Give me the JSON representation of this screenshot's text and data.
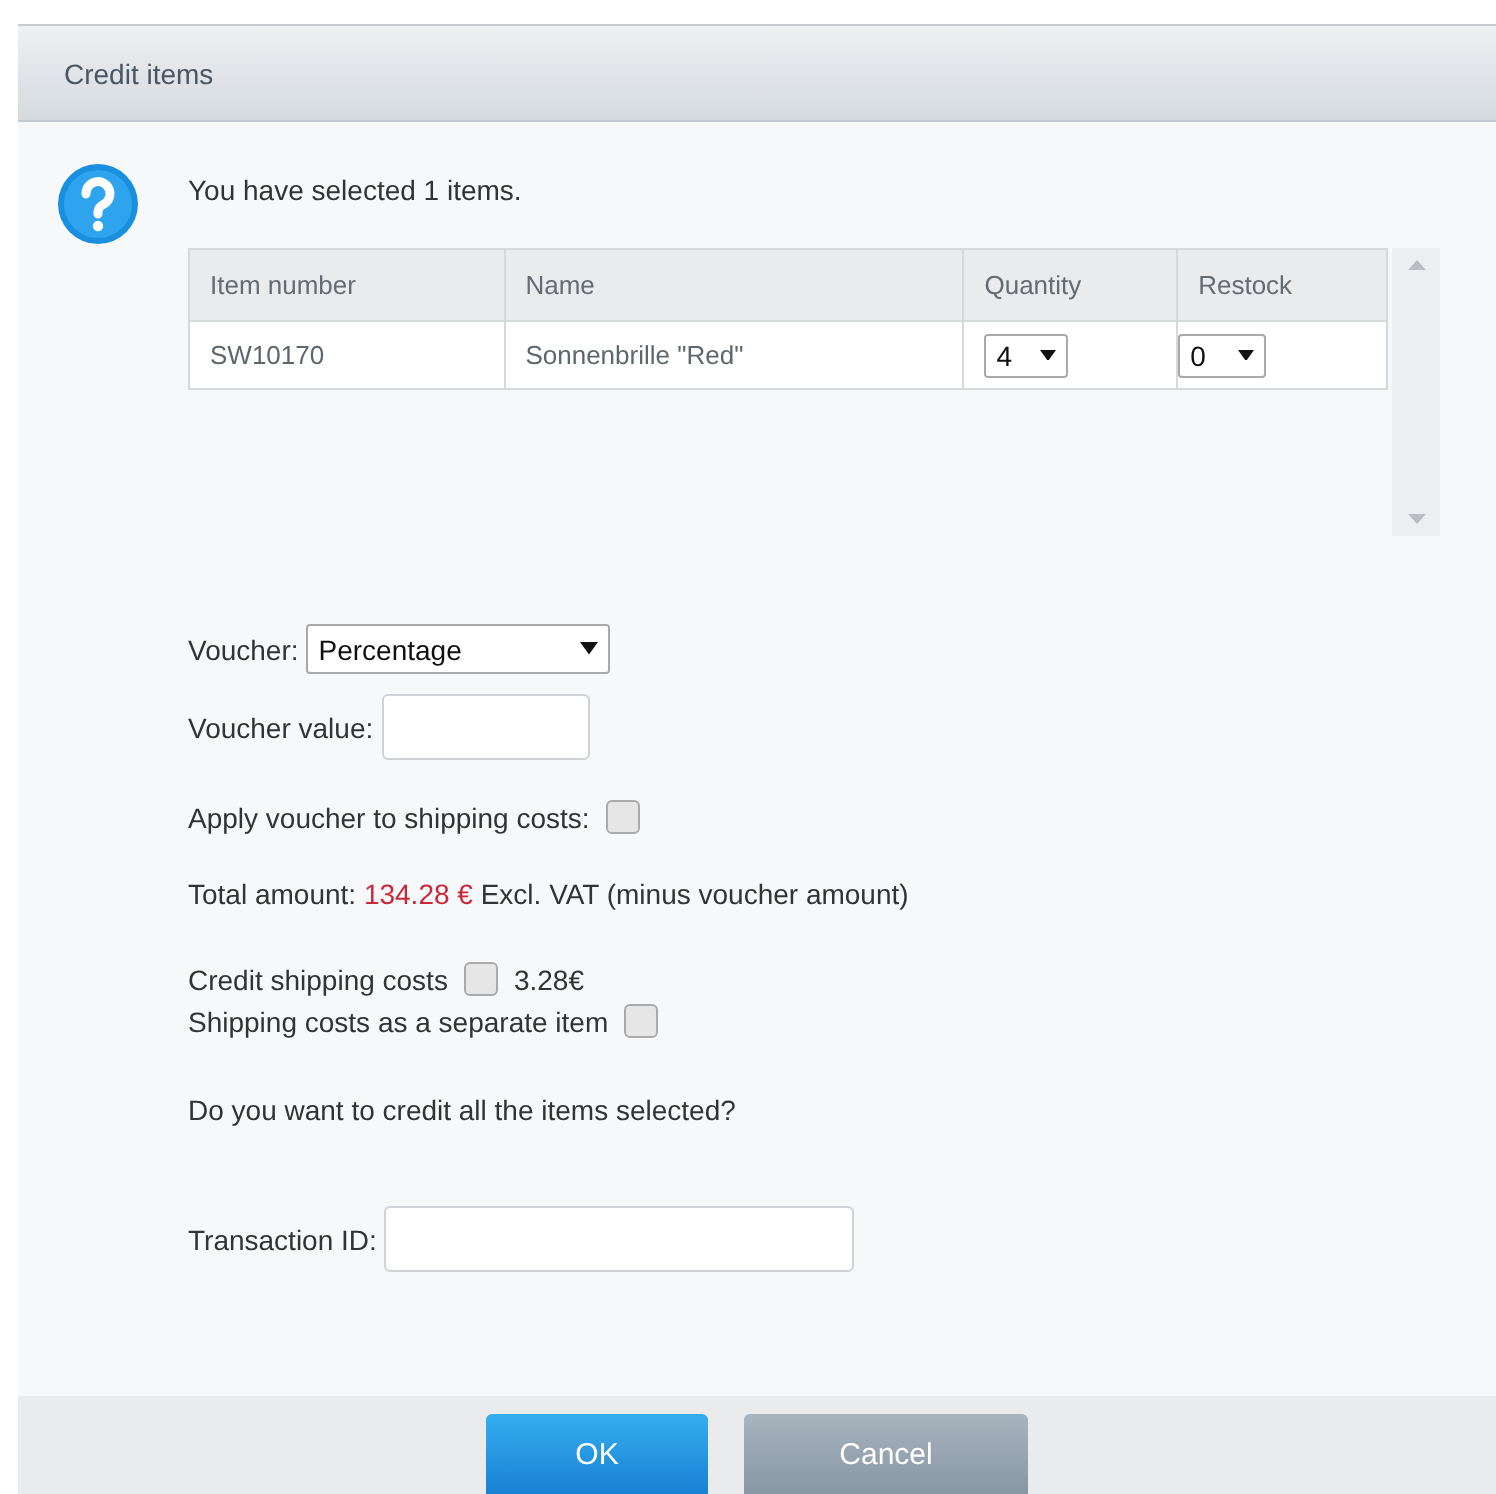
{
  "window": {
    "title": "Credit items"
  },
  "message": "You have selected 1 items.",
  "table": {
    "columns": [
      "Item number",
      "Name",
      "Quantity",
      "Restock"
    ],
    "rows": [
      {
        "item_number": "SW10170",
        "name": "Sonnenbrille \"Red\"",
        "quantity": "4",
        "restock": "0"
      }
    ]
  },
  "voucher": {
    "label": "Voucher:",
    "value": "Percentage"
  },
  "voucher_value": {
    "label": "Voucher value:"
  },
  "apply_voucher": {
    "label": "Apply voucher to shipping costs:",
    "checked": false
  },
  "total": {
    "label": "Total amount:",
    "amount": "134.28 €",
    "suffix": "Excl. VAT (minus voucher amount)"
  },
  "credit_shipping": {
    "label": "Credit shipping costs",
    "checked": false,
    "amount": "3.28€"
  },
  "separate_item": {
    "label": "Shipping costs as a separate item",
    "checked": false
  },
  "question": "Do you want to credit all the items selected?",
  "transaction_id": {
    "label": "Transaction ID:"
  },
  "buttons": [
    {
      "label": "OK",
      "kind": "primary"
    },
    {
      "label": "Cancel",
      "kind": "secondary"
    }
  ]
}
